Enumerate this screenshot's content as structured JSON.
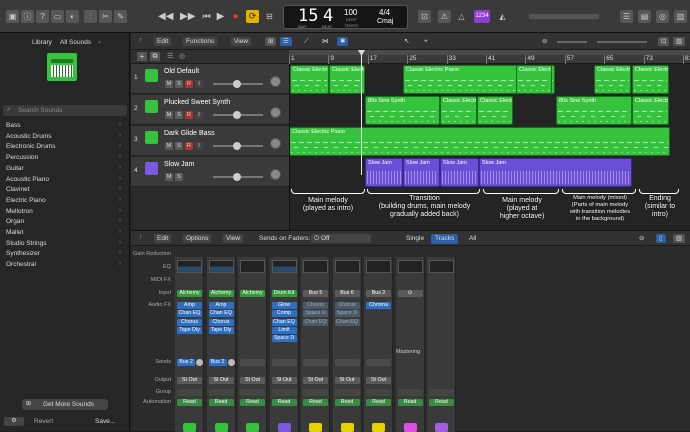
{
  "toolbar": {
    "lcd": {
      "bar": "15",
      "beat": "4",
      "bar_label": "BAR",
      "beat_label": "BEAT",
      "tempo": "100",
      "tempo_label": "TEMPO",
      "keep": "KEEP",
      "sig": "4/4",
      "key": "Cmaj"
    },
    "count_badge": "1234"
  },
  "library": {
    "title": "Library",
    "filter": "All Sounds",
    "search_placeholder": "Search Sounds",
    "items": [
      "Bass",
      "Acoustic Drums",
      "Electronic Drums",
      "Percussion",
      "Guitar",
      "Acoustic Piano",
      "Clavinet",
      "Electric Piano",
      "Mellotron",
      "Organ",
      "Mallet",
      "Studio Strings",
      "Synthesizer",
      "Orchestral"
    ],
    "get_more": "Get More Sounds",
    "revert": "Revert",
    "save": "Save..."
  },
  "tracks_menu": {
    "edit": "Edit",
    "functions": "Functions",
    "view": "View"
  },
  "ruler": [
    "1",
    "9",
    "17",
    "25",
    "33",
    "41",
    "49",
    "57",
    "65",
    "73",
    "81"
  ],
  "tracks": [
    {
      "num": "1",
      "name": "Old Default"
    },
    {
      "num": "2",
      "name": "Plucked Sweet Synth"
    },
    {
      "num": "3",
      "name": "Dark Glide Bass"
    },
    {
      "num": "4",
      "name": "Slow Jam"
    }
  ],
  "msri": [
    "M",
    "S",
    "R",
    "I"
  ],
  "regions": {
    "classic_electric": "Classic Electri",
    "classic_electric_piano": "Classic Electric Piano",
    "classic_electr": "Classic Electr",
    "sine_synth": "80s Sine Synth",
    "classic_electric_p": "Classic Electric P",
    "slow_jam": "Slow Jam"
  },
  "annotations": {
    "a1": "Main melody\n(played as intro)",
    "a2": "Transition\n(building drums, main melody\ngradually added back)",
    "a3": "Main melody\n(played at\nhigher octave)",
    "a4": "Main melody (mixed)\n(Parts of main melody\nwith transition melodies\nin the background)",
    "a5": "Ending\n(similar to\nintro)"
  },
  "mixer": {
    "edit": "Edit",
    "options": "Options",
    "view": "View",
    "sends_on_faders": "Sends on Faders:",
    "sends_value": "Off",
    "single": "Single",
    "tracks": "Tracks",
    "all": "All",
    "row_labels": [
      "Gain Reduction",
      "EQ",
      "MIDI FX",
      "Input",
      "Audio FX",
      "Sends",
      "Output",
      "Group",
      "Automation"
    ],
    "mastering": "Mastering",
    "strips": [
      {
        "input": "Alchemy",
        "fx": [
          "Amp",
          "Chan EQ",
          "Chorus",
          "Tape Dly"
        ],
        "send": "Bus 2",
        "output": "St Out",
        "auto": "Read",
        "icon_color": "#35c23d"
      },
      {
        "input": "Alchemy",
        "fx": [
          "Amp",
          "Chan EQ",
          "Chorus",
          "Tape Dly"
        ],
        "send": "Bus 2",
        "output": "St Out",
        "auto": "Read",
        "icon_color": "#35c23d"
      },
      {
        "input": "Alchemy",
        "fx": [],
        "send": "",
        "output": "St Out",
        "auto": "Read",
        "icon_color": "#35c23d"
      },
      {
        "input": "Drum Kit",
        "fx": [
          "Glow",
          "Comp",
          "Chan EQ",
          "Limit",
          "Space D"
        ],
        "send": "",
        "output": "St Out",
        "auto": "Read",
        "icon_color": "#7a5ae0"
      },
      {
        "input": "Bus 5",
        "fx": [
          "Chorus",
          "Space D",
          "Chan EQ"
        ],
        "send": "",
        "output": "St Out",
        "auto": "Read",
        "icon_color": "#e6d200"
      },
      {
        "input": "Bus 6",
        "fx": [
          "Chorus",
          "Space D",
          "Chan EQ"
        ],
        "send": "",
        "output": "St Out",
        "auto": "Read",
        "icon_color": "#e6d200"
      },
      {
        "input": "Bus 2",
        "fx": [
          "Chroma"
        ],
        "send": "",
        "output": "St Out",
        "auto": "Read",
        "icon_color": "#e6d200"
      },
      {
        "input": "",
        "fx": [],
        "send": "",
        "output": "",
        "auto": "Read",
        "icon_color": "#e050e0"
      },
      {
        "input": "",
        "fx": [],
        "send": "",
        "output": "",
        "auto": "Read",
        "icon_color": "#a060e0"
      }
    ]
  }
}
